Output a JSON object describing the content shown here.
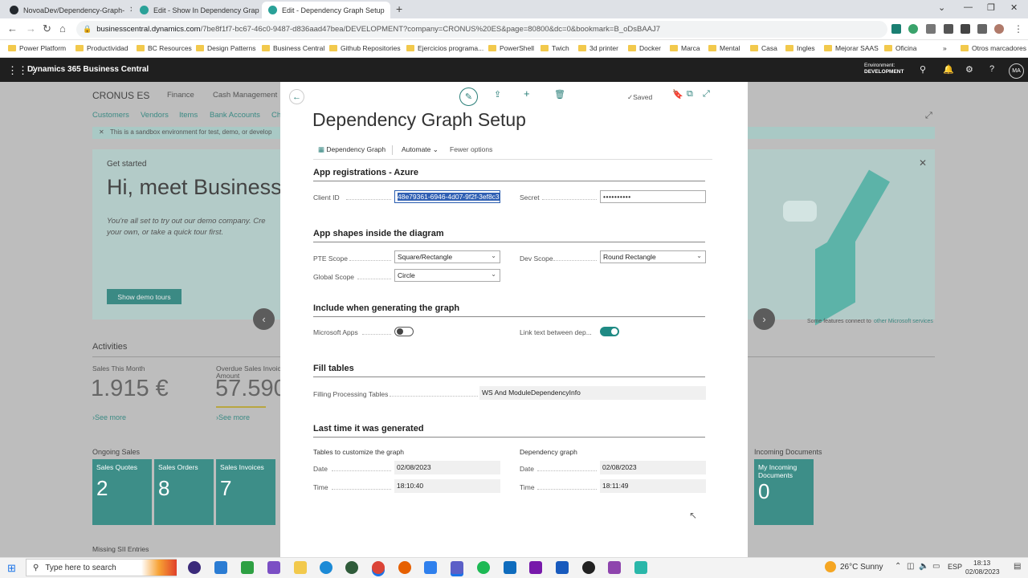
{
  "browser": {
    "tabs": [
      {
        "label": "NovoaDev/Dependency-Graph-",
        "icon": "github-icon",
        "color": "#24292e"
      },
      {
        "label": "Edit - Show In Dependency Grap",
        "icon": "bc-icon",
        "color": "#2aa198"
      },
      {
        "label": "Edit - Dependency Graph Setup",
        "icon": "bc-icon",
        "color": "#2aa198"
      }
    ],
    "url_host": "businesscentral.dynamics.com",
    "url_path": "/7be8f1f7-bc67-46c0-9487-d836aad47bea/DEVELOPMENT?company=CRONUS%20ES&page=80800&dc=0&bookmark=B_oDsBAAJ7",
    "bookmarks": [
      "Power Platform",
      "Productividad",
      "BC Resources",
      "Design Patterns",
      "Business Central",
      "Github Repositories",
      "Ejercicios programa...",
      "PowerShell",
      "Twich",
      "3d printer",
      "Docker",
      "Marca",
      "Mental",
      "Casa",
      "Ingles",
      "Mejorar SAAS",
      "Oficina"
    ],
    "bookmarks_more": "Otros marcadores"
  },
  "bc_header": {
    "product": "Dynamics 365 Business Central",
    "env_label": "Environment:",
    "env_value": "DEVELOPMENT",
    "avatar": "MA"
  },
  "background": {
    "company": "CRONUS ES",
    "nav_menu": [
      "Finance",
      "Cash Management"
    ],
    "nav_links": [
      "Customers",
      "Vendors",
      "Items",
      "Bank Accounts",
      "Ch"
    ],
    "banner": "This is a sandbox environment for test, demo, or develop",
    "get_started": "Get started",
    "hero_title": "Hi, meet Business",
    "hero_text1": "You're all set to try out our demo company. Cre",
    "hero_text2": "your own, or take a quick tour first.",
    "demo_button": "Show demo tours",
    "ms_services_note": "Some features connect to",
    "ms_services_link": "other Microsoft services",
    "activities": "Activities",
    "sales_month_label": "Sales This Month",
    "sales_month_value": "1.915 €",
    "overdue_label1": "Overdue Sales Invoice",
    "overdue_label2": "Amount",
    "overdue_value": "57.590",
    "see_more": "See more",
    "ongoing_sales": "Ongoing Sales",
    "tiles": [
      {
        "label": "Sales Quotes",
        "value": "2"
      },
      {
        "label": "Sales Orders",
        "value": "8"
      },
      {
        "label": "Sales Invoices",
        "value": "7"
      }
    ],
    "incoming_docs": "Incoming Documents",
    "incoming_tile_label1": "My Incoming",
    "incoming_tile_label2": "Documents",
    "incoming_tile_value": "0",
    "missing_sii": "Missing SII Entries"
  },
  "dialog": {
    "saved": "Saved",
    "title": "Dependency Graph Setup",
    "actions": {
      "dependency_graph": "Dependency Graph",
      "automate": "Automate",
      "fewer_options": "Fewer options"
    },
    "sections": {
      "app_reg": "App registrations - Azure",
      "shapes": "App shapes inside the diagram",
      "include": "Include when generating the graph",
      "fill": "Fill tables",
      "last_time": "Last time it was generated"
    },
    "client_id_label": "Client ID",
    "client_id_value": "48e79361-6946-4d07-9f2f-3ef8c3",
    "secret_label": "Secret",
    "secret_value": "••••••••••",
    "pte_scope_label": "PTE Scope",
    "pte_scope_value": "Square/Rectangle",
    "dev_scope_label": "Dev Scope",
    "dev_scope_value": "Round Rectangle",
    "global_scope_label": "Global Scope",
    "global_scope_value": "Circle",
    "ms_apps_label": "Microsoft Apps",
    "ms_apps_on": false,
    "link_text_label": "Link text between dep...",
    "link_text_on": true,
    "filling_label": "Filling Processing Tables",
    "filling_value": "WS And ModuleDependencyInfo",
    "tables_group": "Tables to customize the graph",
    "graph_group": "Dependency graph",
    "date_label": "Date",
    "time_label": "Time",
    "tables_date": "02/08/2023",
    "tables_time": "18:10:40",
    "graph_date": "02/08/2023",
    "graph_time": "18:11:49"
  },
  "taskbar": {
    "search_placeholder": "Type here to search",
    "weather": "26°C  Sunny",
    "lang": "ESP",
    "time": "18:13",
    "date": "02/08/2023"
  },
  "colors": {
    "teal": "#2a7f79",
    "toggle_on": "#1f8a84",
    "dark_header": "#1f1f1f"
  }
}
